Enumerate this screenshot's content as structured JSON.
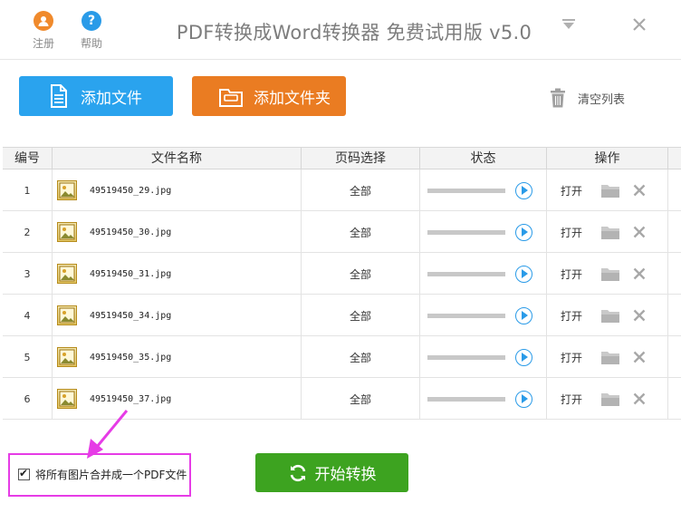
{
  "titlebar": {
    "register_label": "注册",
    "help_label": "帮助",
    "app_title": "PDF转换成Word转换器 免费试用版 v5.0"
  },
  "toolbar": {
    "add_files_label": "添加文件",
    "add_folder_label": "添加文件夹",
    "clear_list_label": "清空列表"
  },
  "table": {
    "headers": {
      "num": "编号",
      "name": "文件名称",
      "page": "页码选择",
      "status": "状态",
      "ops": "操作"
    },
    "rows": [
      {
        "num": "1",
        "name": "49519450_29.jpg",
        "page": "全部",
        "open": "打开"
      },
      {
        "num": "2",
        "name": "49519450_30.jpg",
        "page": "全部",
        "open": "打开"
      },
      {
        "num": "3",
        "name": "49519450_31.jpg",
        "page": "全部",
        "open": "打开"
      },
      {
        "num": "4",
        "name": "49519450_34.jpg",
        "page": "全部",
        "open": "打开"
      },
      {
        "num": "5",
        "name": "49519450_35.jpg",
        "page": "全部",
        "open": "打开"
      },
      {
        "num": "6",
        "name": "49519450_37.jpg",
        "page": "全部",
        "open": "打开"
      }
    ]
  },
  "bottom": {
    "merge_label": "将所有图片合并成一个PDF文件",
    "merge_checked": true,
    "start_label": "开始转换"
  },
  "colors": {
    "accent_blue": "#2aa3ee",
    "accent_orange": "#ea7c22",
    "accent_green": "#3da320",
    "highlight_magenta": "#e63ce6"
  },
  "icons": {
    "register": "user-icon",
    "help": "question-icon",
    "minimize": "minimize-icon",
    "close": "close-icon",
    "add_files": "document-icon",
    "add_folder": "folder-icon",
    "clear": "trash-icon",
    "thumb": "image-icon",
    "play": "play-icon",
    "open_folder": "folder-icon",
    "delete": "delete-icon",
    "start": "refresh-icon"
  }
}
